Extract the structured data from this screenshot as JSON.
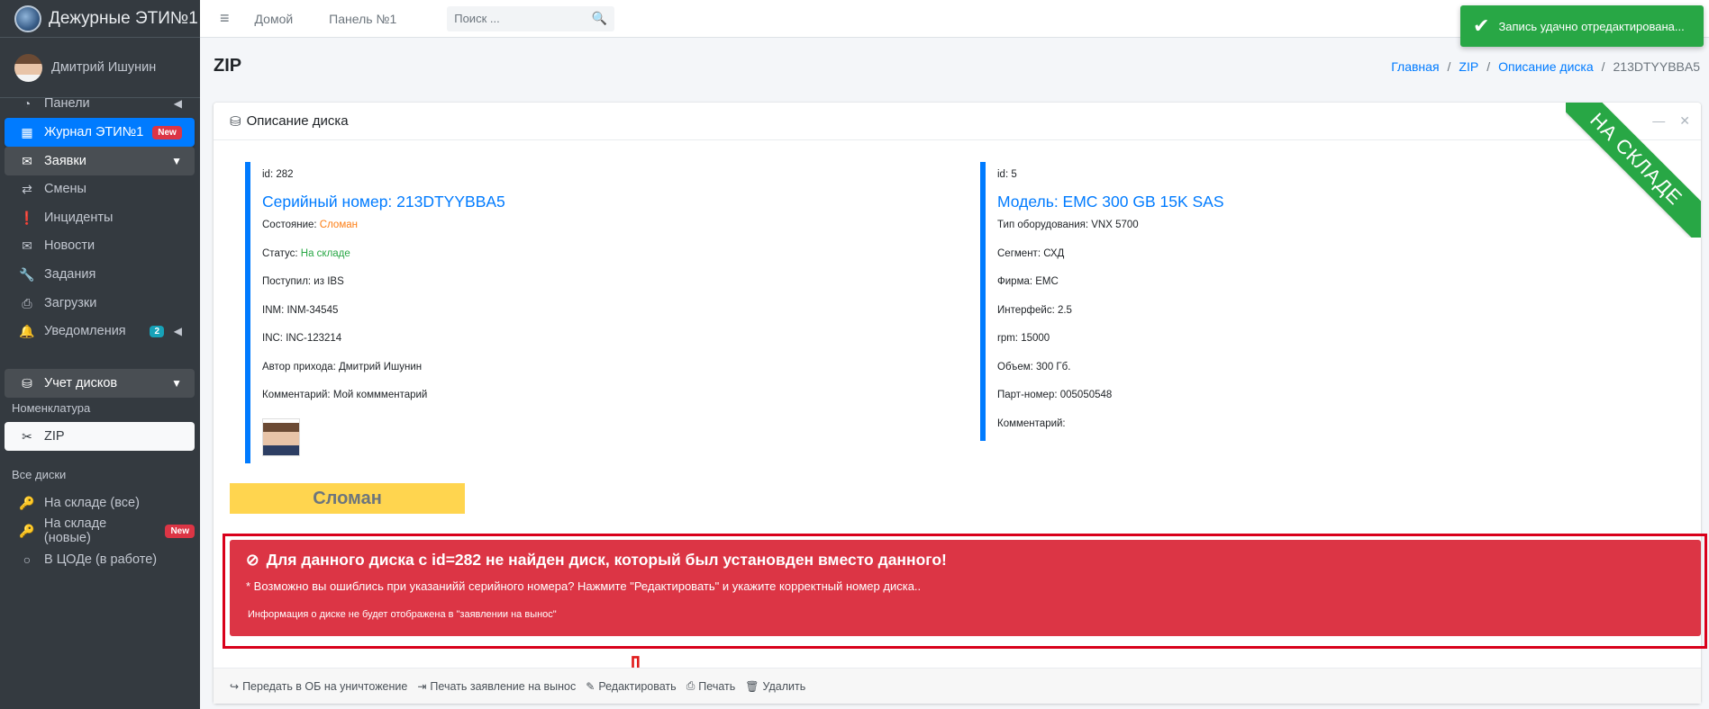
{
  "brand": {
    "title": "Дежурные ЭТИ№1"
  },
  "user": {
    "name": "Дмитрий Ишунин"
  },
  "sidebar": {
    "items": [
      {
        "label": "Панели",
        "icon": "dashboard-icon"
      },
      {
        "label": "Журнал ЭТИ№1",
        "badge": "New",
        "icon": "grid-icon"
      },
      {
        "label": "Заявки",
        "icon": "inbox-icon"
      },
      {
        "label": "Смены",
        "icon": "exchange-icon"
      },
      {
        "label": "Инциденты",
        "icon": "exclamation-icon"
      },
      {
        "label": "Новости",
        "icon": "envelope-open-icon"
      },
      {
        "label": "Задания",
        "icon": "wrench-icon"
      },
      {
        "label": "Загрузки",
        "icon": "file-upload-icon"
      },
      {
        "label": "Уведомления",
        "badge": "2",
        "icon": "bell-icon"
      },
      {
        "label": "Учет дисков",
        "icon": "hdd-icon"
      },
      {
        "label": "ZIP",
        "icon": "zip-icon"
      },
      {
        "label": "На складе (все)",
        "icon": "key-icon"
      },
      {
        "label": "На складе (новые)",
        "badge": "New",
        "icon": "key-icon"
      },
      {
        "label": "В ЦОДе (в работе)",
        "icon": "circle-icon"
      }
    ],
    "headers": {
      "nomenclature": "Номенклатура",
      "all_disks": "Все диски"
    }
  },
  "topbar": {
    "home": "Домой",
    "panel": "Панель №1",
    "search_placeholder": "Поиск ..."
  },
  "toast": {
    "text": "Запись удачно отредактирована..."
  },
  "page": {
    "title": "ZIP"
  },
  "breadcrumb": [
    "Главная",
    "ZIP",
    "Описание диска",
    "213DTYYBBA5"
  ],
  "card": {
    "title": "Описание диска",
    "ribbon": "НА СКЛАДЕ"
  },
  "disk": {
    "id": "id: 282",
    "serial": "Серийный номер: 213DTYYBBA5",
    "state_label": "Состояние:",
    "state_value": "Сломан",
    "status_label": "Статус:",
    "status_value": "На складе",
    "received": "Поступил: из IBS",
    "inm": "INM: INM-34545",
    "inc": "INC: INC-123214",
    "author": "Автор прихода: Дмитрий Ишунин",
    "comment": "Комментарий: Мой коммментарий"
  },
  "model": {
    "id": "id: 5",
    "title": "Модель: EMC 300 GB 15K SAS",
    "equip_type": "Тип оборудования: VNX 5700",
    "segment": "Сегмент: СХД",
    "vendor": "Фирма: EMC",
    "interface": "Интерфейс: 2.5",
    "rpm": "rpm: 15000",
    "volume": "Объем: 300 Гб.",
    "part": "Парт-номер: 005050548",
    "comment": "Комментарий:"
  },
  "broken_badge": "Сломан",
  "alert": {
    "title": "Для данного диска с id=282 не найден диск, который был установден вместо данного!",
    "subtitle": "* Возможно вы ошиблись при указанийй серийного номера? Нажмите \"Редактировать\" и укажите корректный номер диска..",
    "note": "Информация о диске не будет отображена в \"заявлении на вынос\""
  },
  "actions": [
    "Передать в ОБ на уничтожение",
    "Печать заявление на вынос",
    "Редактировать",
    "Печать",
    "Удалить"
  ],
  "colors": {
    "primary": "#007bff",
    "danger": "#dc3545",
    "success": "#28a745",
    "warning": "#ffd54f",
    "sidebar": "#343a40"
  }
}
